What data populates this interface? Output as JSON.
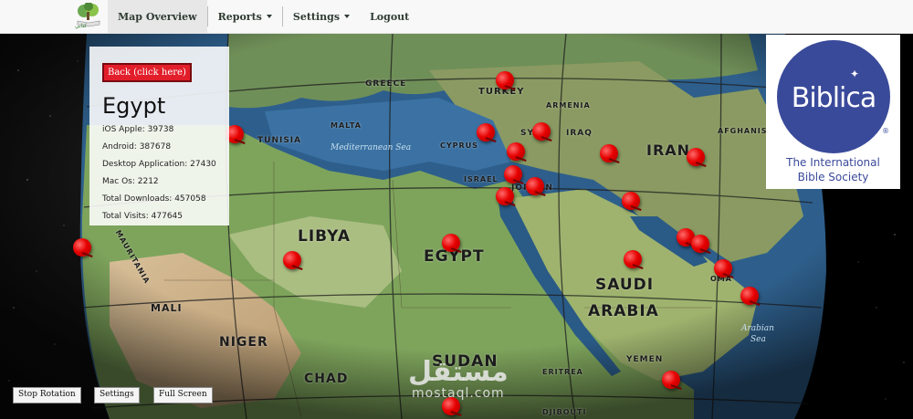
{
  "nav": {
    "logo_text": "كتابي",
    "map_overview": "Map Overview",
    "reports": "Reports",
    "settings": "Settings",
    "logout": "Logout"
  },
  "info_panel": {
    "back_label": "Back (click here)",
    "country": "Egypt",
    "ios_apple": "iOS Apple: 39738",
    "android": "Android: 387678",
    "desktop": "Desktop Application: 27430",
    "mac": "Mac Os: 2212",
    "total_downloads": "Total Downloads: 457058",
    "total_visits": "Total Visits: 477645"
  },
  "biblica": {
    "word": "Biblica",
    "reg": "®",
    "line1": "The International",
    "line2": "Bible Society",
    "brand_color": "#3a4a9a"
  },
  "map_labels": {
    "libya": "LIBYA",
    "egypt": "EGYPT",
    "saudi": "SAUDI",
    "arabia": "ARABIA",
    "niger": "NIGER",
    "chad": "CHAD",
    "sudan": "SUDAN",
    "mali": "MALI",
    "tunisia": "TUNISIA",
    "mauritania": "MAURITANIA",
    "turkey": "TURKEY",
    "greece": "GREECE",
    "cyprus": "CYPRUS",
    "syria": "SYR",
    "iraq": "IRAQ",
    "iran": "IRAN",
    "israel": "ISRAEL",
    "jordan": "JORDAN",
    "armenia": "ARMENIA",
    "afghanistan": "AFGHANISTA",
    "yemen": "YEMEN",
    "eritrea": "ERITREA",
    "djibouti": "DJIBOUTI",
    "oman": "OMA",
    "malta": "MALTA",
    "med_sea": "Mediterranean Sea",
    "arabian_sea_1": "Arabian",
    "arabian_sea_2": "Sea"
  },
  "controls": {
    "stop_rotation": "Stop Rotation",
    "settings": "Settings",
    "full_screen": "Full Screen"
  },
  "watermark": {
    "arabic": "مستقل",
    "latin": "mostaql.com"
  },
  "colors": {
    "pin": "#e60000",
    "back_button": "#e21e2b",
    "ocean": "#2e5f8c",
    "land": "#6f9a55",
    "desert": "#c9b08a"
  }
}
